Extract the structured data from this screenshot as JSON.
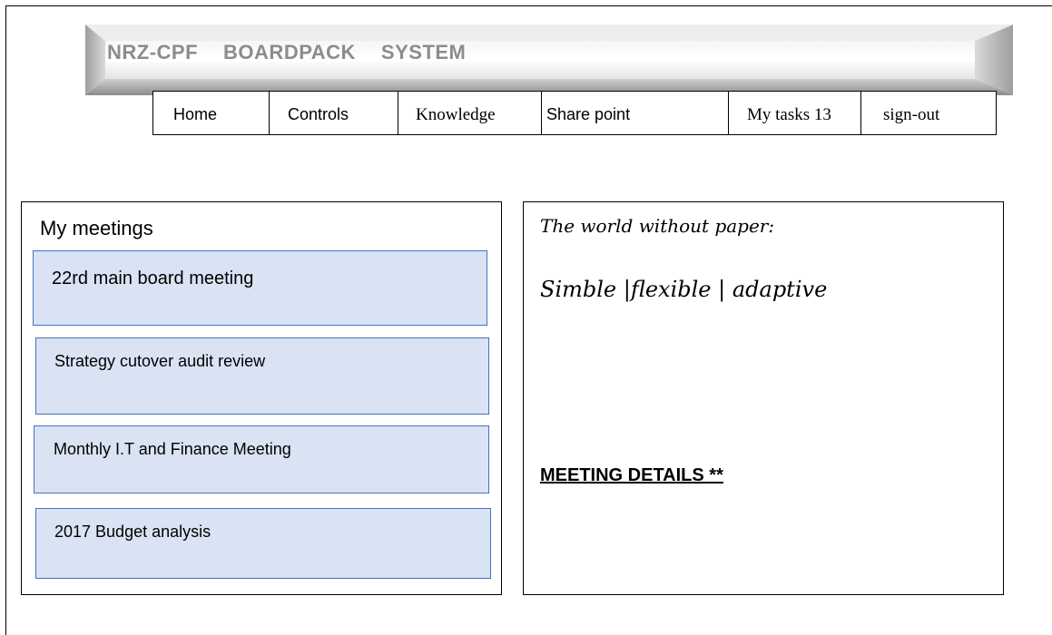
{
  "header": {
    "title_parts": [
      "NRZ-CPF",
      "BOARDPACK",
      "SYSTEM"
    ]
  },
  "nav": {
    "tabs": [
      {
        "label": "Home"
      },
      {
        "label": "Controls"
      },
      {
        "label": "Knowledge"
      },
      {
        "label": "Share point"
      },
      {
        "label": "My tasks 13"
      },
      {
        "label": "sign-out"
      }
    ]
  },
  "meetings": {
    "heading": "My meetings",
    "items": [
      {
        "label": "22rd main board meeting"
      },
      {
        "label": "Strategy cutover audit review"
      },
      {
        "label": "Monthly I.T and Finance Meeting"
      },
      {
        "label": "2017 Budget analysis"
      }
    ]
  },
  "info": {
    "tagline_1": "The world without paper:",
    "tagline_2": "Simble |flexible | adaptive",
    "details_link": "MEETING DETAILS **"
  },
  "colors": {
    "meeting_fill": "#dae3f3",
    "meeting_border": "#4472c4",
    "banner_text": "#8c8c8c"
  }
}
